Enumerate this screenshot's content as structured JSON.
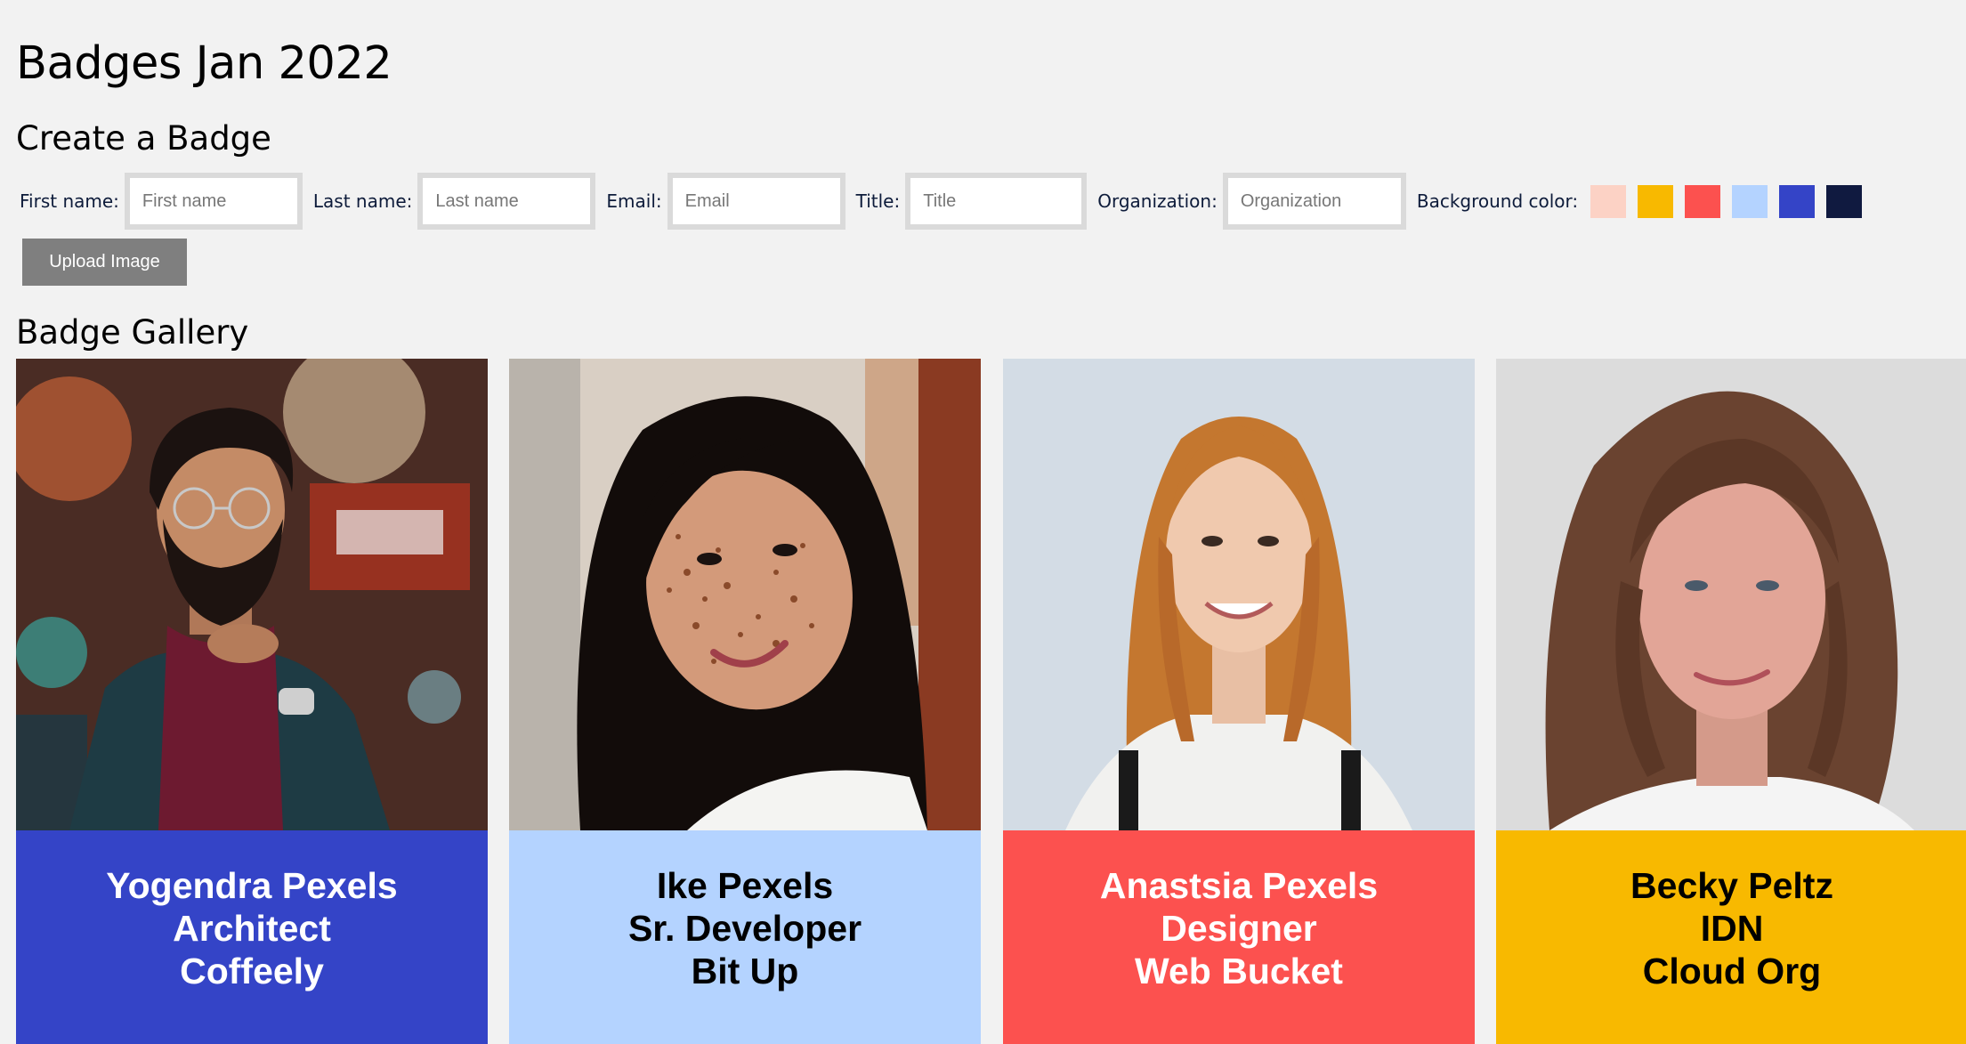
{
  "page": {
    "title": "Badges Jan 2022"
  },
  "create": {
    "heading": "Create a Badge",
    "fields": {
      "first_name": {
        "label": "First name:",
        "placeholder": "First name",
        "value": ""
      },
      "last_name": {
        "label": "Last name:",
        "placeholder": "Last name",
        "value": ""
      },
      "email": {
        "label": "Email:",
        "placeholder": "Email",
        "value": ""
      },
      "title": {
        "label": "Title:",
        "placeholder": "Title",
        "value": ""
      },
      "organization": {
        "label": "Organization:",
        "placeholder": "Organization",
        "value": ""
      }
    },
    "background_label": "Background color:",
    "colors": [
      "#fcd2c5",
      "#f8b900",
      "#fc514f",
      "#b4d3ff",
      "#3444c7",
      "#101a40"
    ],
    "upload_label": "Upload Image"
  },
  "gallery": {
    "heading": "Badge Gallery",
    "badges": [
      {
        "name": "Yogendra Pexels",
        "title": "Architect",
        "org": "Coffeely",
        "bg": "#3444c7",
        "text_color": "#ffffff",
        "photo": "man-glasses-beard-portrait"
      },
      {
        "name": "Ike Pexels",
        "title": "Sr. Developer",
        "org": "Bit Up",
        "bg": "#b4d3ff",
        "text_color": "#000000",
        "photo": "woman-freckles-portrait"
      },
      {
        "name": "Anastsia Pexels",
        "title": "Designer",
        "org": "Web Bucket",
        "bg": "#fc514f",
        "text_color": "#ffffff",
        "photo": "woman-red-hair-portrait"
      },
      {
        "name": "Becky Peltz",
        "title": "IDN",
        "org": "Cloud Org",
        "bg": "#f8b900",
        "text_color": "#000000",
        "photo": "woman-curly-hair-portrait"
      }
    ]
  }
}
